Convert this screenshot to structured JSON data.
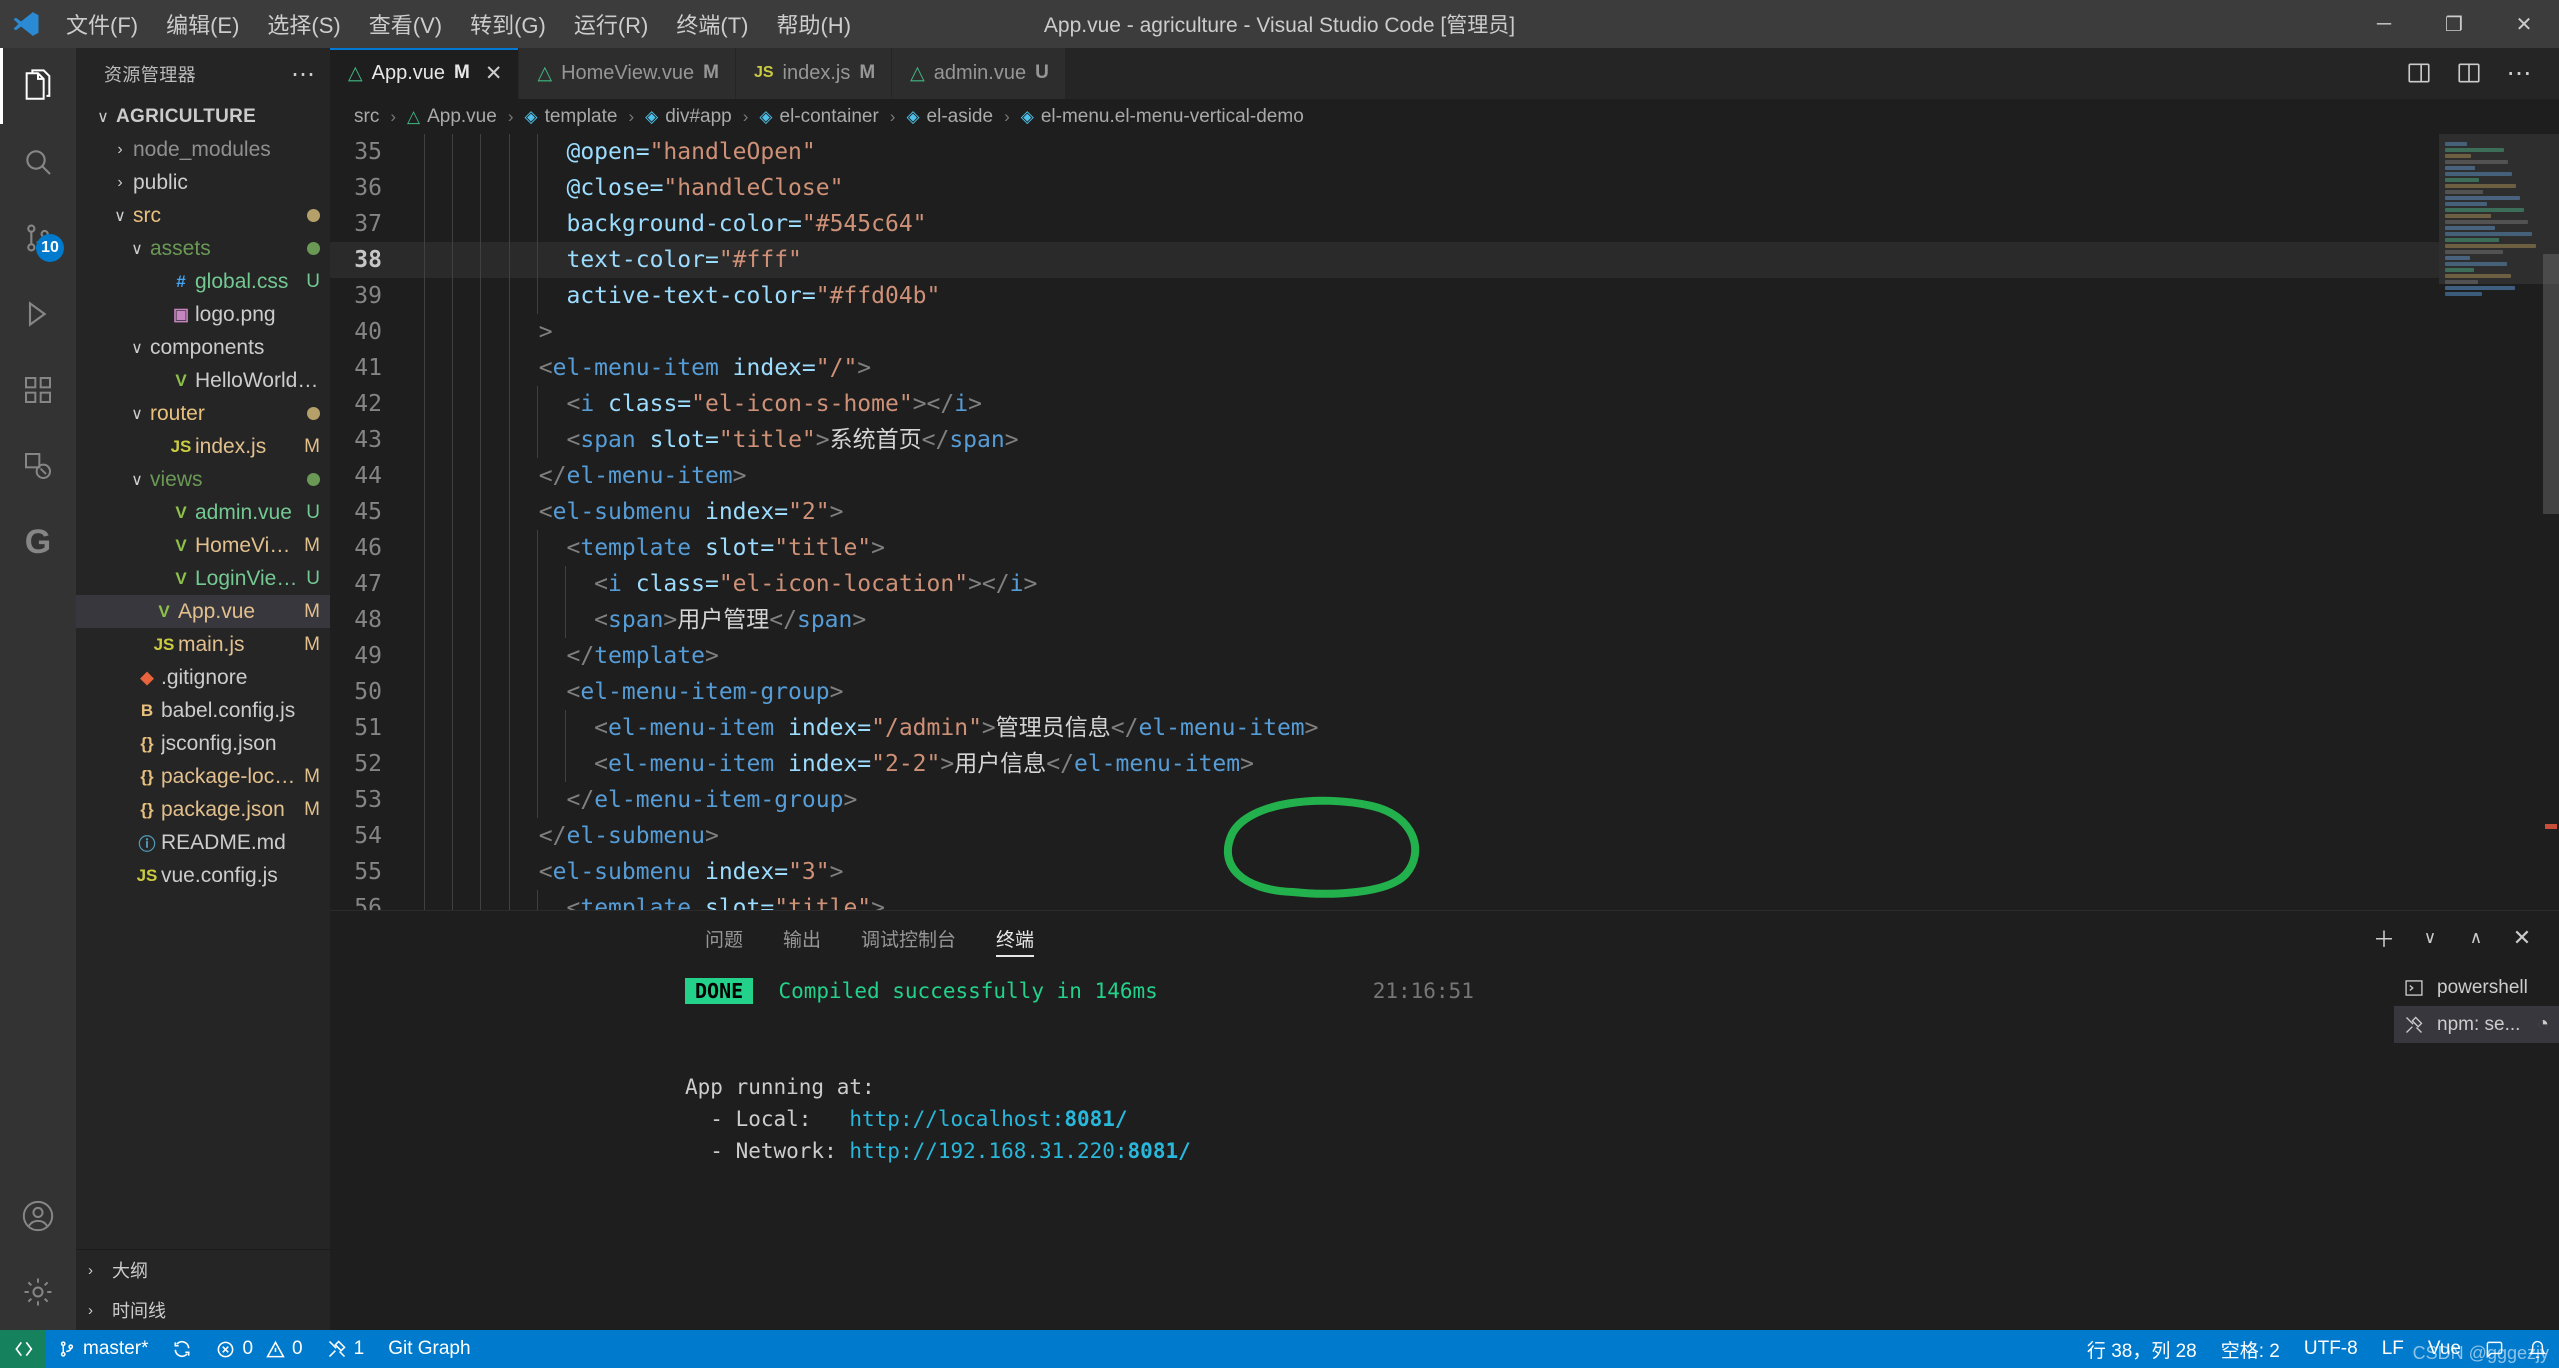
{
  "titlebar": {
    "logo_icon": "vscode-logo-icon",
    "menus": [
      {
        "label": "文件(F)"
      },
      {
        "label": "编辑(E)"
      },
      {
        "label": "选择(S)"
      },
      {
        "label": "查看(V)"
      },
      {
        "label": "转到(G)"
      },
      {
        "label": "运行(R)"
      },
      {
        "label": "终端(T)"
      },
      {
        "label": "帮助(H)"
      }
    ],
    "window_title": "App.vue - agriculture - Visual Studio Code [管理员]",
    "minimize_label": "─",
    "maximize_label": "❐",
    "close_label": "✕"
  },
  "activitybar": {
    "items": [
      {
        "name": "explorer",
        "icon": "files-icon",
        "badge": ""
      },
      {
        "name": "search",
        "icon": "search-icon",
        "badge": ""
      },
      {
        "name": "source-control",
        "icon": "source-control-icon",
        "badge": "10"
      },
      {
        "name": "run-debug",
        "icon": "debug-icon",
        "badge": ""
      },
      {
        "name": "extensions",
        "icon": "extensions-icon",
        "badge": ""
      },
      {
        "name": "remote-explorer",
        "icon": "remote-explorer-icon",
        "badge": ""
      },
      {
        "name": "git-graph",
        "icon": "git-graph-icon",
        "badge": ""
      }
    ],
    "bottom": [
      {
        "name": "account",
        "icon": "account-icon"
      },
      {
        "name": "settings",
        "icon": "gear-icon"
      }
    ]
  },
  "sidebar": {
    "title": "资源管理器",
    "more_label": "⋯",
    "root": "AGRICULTURE",
    "tree": [
      {
        "label": "node_modules",
        "indent": 1,
        "twisty": "›",
        "icon": "",
        "icon_color": "",
        "color": "#8f8f8f",
        "badge": "",
        "badge_color": "",
        "dot": ""
      },
      {
        "label": "public",
        "indent": 1,
        "twisty": "›",
        "icon": "",
        "icon_color": "",
        "color": "#cccccc",
        "badge": "",
        "badge_color": "",
        "dot": ""
      },
      {
        "label": "src",
        "indent": 1,
        "twisty": "∨",
        "icon": "",
        "icon_color": "",
        "color": "#e8c07d",
        "badge": "",
        "badge_color": "",
        "dot": "#b5a06a"
      },
      {
        "label": "assets",
        "indent": 2,
        "twisty": "∨",
        "icon": "",
        "icon_color": "",
        "color": "#6a9955",
        "badge": "",
        "badge_color": "",
        "dot": "#6a9955"
      },
      {
        "label": "global.css",
        "indent": 3,
        "twisty": "",
        "icon": "#",
        "icon_color": "#42a5f5",
        "color": "#73c991",
        "badge": "U",
        "badge_color": "#73c991",
        "dot": ""
      },
      {
        "label": "logo.png",
        "indent": 3,
        "twisty": "",
        "icon": "▣",
        "icon_color": "#c586c0",
        "color": "#cccccc",
        "badge": "",
        "badge_color": "",
        "dot": ""
      },
      {
        "label": "components",
        "indent": 2,
        "twisty": "∨",
        "icon": "",
        "icon_color": "",
        "color": "#cccccc",
        "badge": "",
        "badge_color": "",
        "dot": ""
      },
      {
        "label": "HelloWorld.vue",
        "indent": 3,
        "twisty": "",
        "icon": "V",
        "icon_color": "#8dc149",
        "color": "#cccccc",
        "badge": "",
        "badge_color": "",
        "dot": ""
      },
      {
        "label": "router",
        "indent": 2,
        "twisty": "∨",
        "icon": "",
        "icon_color": "",
        "color": "#e8c07d",
        "badge": "",
        "badge_color": "",
        "dot": "#b5a06a"
      },
      {
        "label": "index.js",
        "indent": 3,
        "twisty": "",
        "icon": "JS",
        "icon_color": "#cbcb41",
        "color": "#e2c08d",
        "badge": "M",
        "badge_color": "#e2c08d",
        "dot": ""
      },
      {
        "label": "views",
        "indent": 2,
        "twisty": "∨",
        "icon": "",
        "icon_color": "",
        "color": "#6a9955",
        "badge": "",
        "badge_color": "",
        "dot": "#6a9955"
      },
      {
        "label": "admin.vue",
        "indent": 3,
        "twisty": "",
        "icon": "V",
        "icon_color": "#8dc149",
        "color": "#73c991",
        "badge": "U",
        "badge_color": "#73c991",
        "dot": ""
      },
      {
        "label": "HomeView.vue",
        "indent": 3,
        "twisty": "",
        "icon": "V",
        "icon_color": "#8dc149",
        "color": "#e2c08d",
        "badge": "M",
        "badge_color": "#e2c08d",
        "dot": ""
      },
      {
        "label": "LoginView.vue",
        "indent": 3,
        "twisty": "",
        "icon": "V",
        "icon_color": "#8dc149",
        "color": "#73c991",
        "badge": "U",
        "badge_color": "#73c991",
        "dot": ""
      },
      {
        "label": "App.vue",
        "indent": 2,
        "twisty": "",
        "icon": "V",
        "icon_color": "#8dc149",
        "color": "#e2c08d",
        "badge": "M",
        "badge_color": "#e2c08d",
        "dot": "",
        "selected": true
      },
      {
        "label": "main.js",
        "indent": 2,
        "twisty": "",
        "icon": "JS",
        "icon_color": "#cbcb41",
        "color": "#e2c08d",
        "badge": "M",
        "badge_color": "#e2c08d",
        "dot": ""
      },
      {
        "label": ".gitignore",
        "indent": 1,
        "twisty": "",
        "icon": "◆",
        "icon_color": "#e8643c",
        "color": "#cccccc",
        "badge": "",
        "badge_color": "",
        "dot": ""
      },
      {
        "label": "babel.config.js",
        "indent": 1,
        "twisty": "",
        "icon": "B",
        "icon_color": "#e8c07d",
        "color": "#cccccc",
        "badge": "",
        "badge_color": "",
        "dot": ""
      },
      {
        "label": "jsconfig.json",
        "indent": 1,
        "twisty": "",
        "icon": "{}",
        "icon_color": "#e8c07d",
        "color": "#cccccc",
        "badge": "",
        "badge_color": "",
        "dot": ""
      },
      {
        "label": "package-lock.json",
        "indent": 1,
        "twisty": "",
        "icon": "{}",
        "icon_color": "#e8c07d",
        "color": "#e2c08d",
        "badge": "M",
        "badge_color": "#e2c08d",
        "dot": ""
      },
      {
        "label": "package.json",
        "indent": 1,
        "twisty": "",
        "icon": "{}",
        "icon_color": "#e8c07d",
        "color": "#e2c08d",
        "badge": "M",
        "badge_color": "#e2c08d",
        "dot": ""
      },
      {
        "label": "README.md",
        "indent": 1,
        "twisty": "",
        "icon": "ⓘ",
        "icon_color": "#519aba",
        "color": "#cccccc",
        "badge": "",
        "badge_color": "",
        "dot": ""
      },
      {
        "label": "vue.config.js",
        "indent": 1,
        "twisty": "",
        "icon": "JS",
        "icon_color": "#cbcb41",
        "color": "#cccccc",
        "badge": "",
        "badge_color": "",
        "dot": ""
      }
    ],
    "sections": [
      {
        "label": "大纲"
      },
      {
        "label": "时间线"
      }
    ]
  },
  "tabs": [
    {
      "label": "App.vue",
      "icon": "vue-icon",
      "modified": "M",
      "active": true,
      "close": "✕"
    },
    {
      "label": "HomeView.vue",
      "icon": "vue-icon",
      "modified": "M",
      "active": false,
      "close": ""
    },
    {
      "label": "index.js",
      "icon": "js-icon",
      "modified": "M",
      "active": false,
      "close": ""
    },
    {
      "label": "admin.vue",
      "icon": "vue-icon",
      "modified": "U",
      "active": false,
      "close": ""
    }
  ],
  "tab_actions": [
    {
      "name": "split-editor-icon",
      "glyph": "◫"
    },
    {
      "name": "open-changes-icon",
      "glyph": "⧉"
    },
    {
      "name": "more-actions-icon",
      "glyph": "⋯"
    }
  ],
  "breadcrumb": [
    {
      "label": "src",
      "icon": ""
    },
    {
      "label": "App.vue",
      "icon": "vue-icon"
    },
    {
      "label": "template",
      "icon": "cube-icon"
    },
    {
      "label": "div#app",
      "icon": "cube-icon"
    },
    {
      "label": "el-container",
      "icon": "cube-icon"
    },
    {
      "label": "el-aside",
      "icon": "cube-icon"
    },
    {
      "label": "el-menu.el-menu-vertical-demo",
      "icon": "cube-icon"
    }
  ],
  "editor": {
    "first_line": 35,
    "highlight_line": 38,
    "lines": [
      {
        "n": 35,
        "indent": 5,
        "tokens": [
          {
            "t": "@open=",
            "c": "t-attr"
          },
          {
            "t": "\"handleOpen\"",
            "c": "t-str"
          }
        ]
      },
      {
        "n": 36,
        "indent": 5,
        "tokens": [
          {
            "t": "@close=",
            "c": "t-attr"
          },
          {
            "t": "\"handleClose\"",
            "c": "t-str"
          }
        ]
      },
      {
        "n": 37,
        "indent": 5,
        "tokens": [
          {
            "t": "background-color=",
            "c": "t-attr"
          },
          {
            "t": "\"#545c64\"",
            "c": "t-str"
          }
        ]
      },
      {
        "n": 38,
        "indent": 5,
        "tokens": [
          {
            "t": "text-color=",
            "c": "t-attr"
          },
          {
            "t": "\"#fff\"",
            "c": "t-str"
          }
        ]
      },
      {
        "n": 39,
        "indent": 5,
        "tokens": [
          {
            "t": "active-text-color=",
            "c": "t-attr"
          },
          {
            "t": "\"#ffd04b\"",
            "c": "t-str"
          }
        ]
      },
      {
        "n": 40,
        "indent": 4,
        "tokens": [
          {
            "t": ">",
            "c": "t-brk"
          }
        ]
      },
      {
        "n": 41,
        "indent": 4,
        "tokens": [
          {
            "t": "<",
            "c": "t-brk"
          },
          {
            "t": "el-menu-item",
            "c": "t-tag"
          },
          {
            "t": " index=",
            "c": "t-attr"
          },
          {
            "t": "\"/\"",
            "c": "t-str"
          },
          {
            "t": ">",
            "c": "t-brk"
          }
        ]
      },
      {
        "n": 42,
        "indent": 5,
        "tokens": [
          {
            "t": "<",
            "c": "t-brk"
          },
          {
            "t": "i",
            "c": "t-tag"
          },
          {
            "t": " class=",
            "c": "t-attr"
          },
          {
            "t": "\"el-icon-s-home\"",
            "c": "t-str"
          },
          {
            "t": "></",
            "c": "t-brk"
          },
          {
            "t": "i",
            "c": "t-tag"
          },
          {
            "t": ">",
            "c": "t-brk"
          }
        ]
      },
      {
        "n": 43,
        "indent": 5,
        "tokens": [
          {
            "t": "<",
            "c": "t-brk"
          },
          {
            "t": "span",
            "c": "t-tag"
          },
          {
            "t": " slot=",
            "c": "t-attr"
          },
          {
            "t": "\"title\"",
            "c": "t-str"
          },
          {
            "t": ">",
            "c": "t-brk"
          },
          {
            "t": "系统首页",
            "c": "t-txt"
          },
          {
            "t": "</",
            "c": "t-brk"
          },
          {
            "t": "span",
            "c": "t-tag"
          },
          {
            "t": ">",
            "c": "t-brk"
          }
        ]
      },
      {
        "n": 44,
        "indent": 4,
        "tokens": [
          {
            "t": "</",
            "c": "t-brk"
          },
          {
            "t": "el-menu-item",
            "c": "t-tag"
          },
          {
            "t": ">",
            "c": "t-brk"
          }
        ]
      },
      {
        "n": 45,
        "indent": 4,
        "tokens": [
          {
            "t": "<",
            "c": "t-brk"
          },
          {
            "t": "el-submenu",
            "c": "t-tag"
          },
          {
            "t": " index=",
            "c": "t-attr"
          },
          {
            "t": "\"2\"",
            "c": "t-str"
          },
          {
            "t": ">",
            "c": "t-brk"
          }
        ]
      },
      {
        "n": 46,
        "indent": 5,
        "tokens": [
          {
            "t": "<",
            "c": "t-brk"
          },
          {
            "t": "template",
            "c": "t-tag"
          },
          {
            "t": " slot=",
            "c": "t-attr"
          },
          {
            "t": "\"title\"",
            "c": "t-str"
          },
          {
            "t": ">",
            "c": "t-brk"
          }
        ]
      },
      {
        "n": 47,
        "indent": 6,
        "tokens": [
          {
            "t": "<",
            "c": "t-brk"
          },
          {
            "t": "i",
            "c": "t-tag"
          },
          {
            "t": " class=",
            "c": "t-attr"
          },
          {
            "t": "\"el-icon-location\"",
            "c": "t-str"
          },
          {
            "t": "></",
            "c": "t-brk"
          },
          {
            "t": "i",
            "c": "t-tag"
          },
          {
            "t": ">",
            "c": "t-brk"
          }
        ]
      },
      {
        "n": 48,
        "indent": 6,
        "tokens": [
          {
            "t": "<",
            "c": "t-brk"
          },
          {
            "t": "span",
            "c": "t-tag"
          },
          {
            "t": ">",
            "c": "t-brk"
          },
          {
            "t": "用户管理",
            "c": "t-txt"
          },
          {
            "t": "</",
            "c": "t-brk"
          },
          {
            "t": "span",
            "c": "t-tag"
          },
          {
            "t": ">",
            "c": "t-brk"
          }
        ]
      },
      {
        "n": 49,
        "indent": 5,
        "tokens": [
          {
            "t": "</",
            "c": "t-brk"
          },
          {
            "t": "template",
            "c": "t-tag"
          },
          {
            "t": ">",
            "c": "t-brk"
          }
        ]
      },
      {
        "n": 50,
        "indent": 5,
        "tokens": [
          {
            "t": "<",
            "c": "t-brk"
          },
          {
            "t": "el-menu-item-group",
            "c": "t-tag"
          },
          {
            "t": ">",
            "c": "t-brk"
          }
        ]
      },
      {
        "n": 51,
        "indent": 6,
        "tokens": [
          {
            "t": "<",
            "c": "t-brk"
          },
          {
            "t": "el-menu-item",
            "c": "t-tag"
          },
          {
            "t": " index=",
            "c": "t-attr"
          },
          {
            "t": "\"/admin\"",
            "c": "t-str"
          },
          {
            "t": ">",
            "c": "t-brk"
          },
          {
            "t": "管理员信息",
            "c": "t-txt"
          },
          {
            "t": "</",
            "c": "t-brk"
          },
          {
            "t": "el-menu-item",
            "c": "t-tag"
          },
          {
            "t": ">",
            "c": "t-brk"
          }
        ]
      },
      {
        "n": 52,
        "indent": 6,
        "tokens": [
          {
            "t": "<",
            "c": "t-brk"
          },
          {
            "t": "el-menu-item",
            "c": "t-tag"
          },
          {
            "t": " index=",
            "c": "t-attr"
          },
          {
            "t": "\"2-2\"",
            "c": "t-str"
          },
          {
            "t": ">",
            "c": "t-brk"
          },
          {
            "t": "用户信息",
            "c": "t-txt"
          },
          {
            "t": "</",
            "c": "t-brk"
          },
          {
            "t": "el-menu-item",
            "c": "t-tag"
          },
          {
            "t": ">",
            "c": "t-brk"
          }
        ]
      },
      {
        "n": 53,
        "indent": 5,
        "tokens": [
          {
            "t": "</",
            "c": "t-brk"
          },
          {
            "t": "el-menu-item-group",
            "c": "t-tag"
          },
          {
            "t": ">",
            "c": "t-brk"
          }
        ]
      },
      {
        "n": 54,
        "indent": 4,
        "tokens": [
          {
            "t": "</",
            "c": "t-brk"
          },
          {
            "t": "el-submenu",
            "c": "t-tag"
          },
          {
            "t": ">",
            "c": "t-brk"
          }
        ]
      },
      {
        "n": 55,
        "indent": 4,
        "tokens": [
          {
            "t": "<",
            "c": "t-brk"
          },
          {
            "t": "el-submenu",
            "c": "t-tag"
          },
          {
            "t": " index=",
            "c": "t-attr"
          },
          {
            "t": "\"3\"",
            "c": "t-str"
          },
          {
            "t": ">",
            "c": "t-brk"
          }
        ]
      },
      {
        "n": 56,
        "indent": 5,
        "tokens": [
          {
            "t": "<",
            "c": "t-brk"
          },
          {
            "t": "template",
            "c": "t-tag"
          },
          {
            "t": " slot=",
            "c": "t-attr"
          },
          {
            "t": "\"title\"",
            "c": "t-str"
          },
          {
            "t": ">",
            "c": "t-brk"
          }
        ]
      }
    ],
    "annotation": {
      "shape": "hand-drawn-circle",
      "color": "#22b14c",
      "target": "\"/admin\""
    }
  },
  "panel": {
    "tabs": [
      {
        "label": "问题",
        "active": false
      },
      {
        "label": "输出",
        "active": false
      },
      {
        "label": "调试控制台",
        "active": false
      },
      {
        "label": "终端",
        "active": true
      }
    ],
    "actions": [
      {
        "name": "new-terminal-icon",
        "glyph": "＋"
      },
      {
        "name": "terminal-dropdown-icon",
        "glyph": "∨"
      },
      {
        "name": "maximize-panel-icon",
        "glyph": "∧"
      },
      {
        "name": "close-panel-icon",
        "glyph": "✕"
      }
    ],
    "terminal": {
      "status_badge": "DONE",
      "status_text": "Compiled successfully in 146ms",
      "timestamp": "21:16:51",
      "app_running_label": "App running at:",
      "local_label": "  - Local:   ",
      "local_url_base": "http://localhost:",
      "local_port": "8081/",
      "network_label": "  - Network: ",
      "network_url_base": "http://192.168.31.220:",
      "network_port": "8081/"
    },
    "terminal_list": [
      {
        "label": "powershell",
        "icon": "terminal-icon",
        "active": false,
        "spinner": ""
      },
      {
        "label": "npm: se...",
        "icon": "tools-icon",
        "active": true,
        "spinner": "◔"
      }
    ]
  },
  "statusbar": {
    "remote_icon": "remote-indicator-icon",
    "branch": "master*",
    "sync_icon": "sync-icon",
    "errors": "0",
    "warnings": "0",
    "ports": "1",
    "git_graph": "Git Graph",
    "cursor_position": "行 38，列 28",
    "indentation": "空格: 2",
    "encoding": "UTF-8",
    "eol": "LF",
    "language": "Vue",
    "bell_icon": "bell-icon",
    "feedback_icon": "feedback-icon",
    "watermark": "CSDN @gggezjy"
  }
}
